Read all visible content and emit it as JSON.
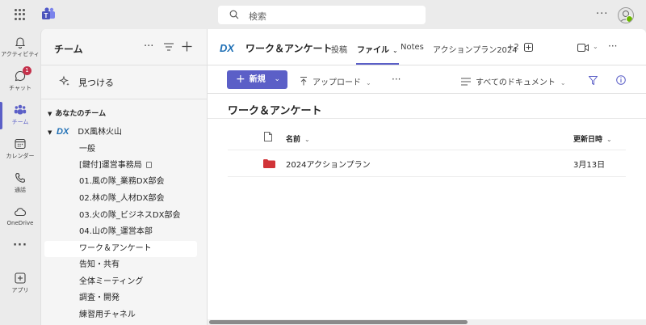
{
  "topbar": {
    "search_placeholder": "検索",
    "more": "···"
  },
  "rail": {
    "activity": "アクティビティ",
    "chat": "チャット",
    "chat_badge": "1",
    "teams": "チーム",
    "calendar": "カレンダー",
    "calls": "通話",
    "onedrive": "OneDrive",
    "more": "···",
    "apps": "アプリ"
  },
  "panel": {
    "title": "チーム",
    "more": "···",
    "discover": "見つける",
    "section": "あなたのチーム",
    "team_name": "DX風林火山",
    "channels": [
      "一般",
      "[鍵付]運営事務局",
      "01.風の隊_業務DX部会",
      "02.林の隊_人材DX部会",
      "03.火の隊_ビジネスDX部会",
      "04.山の隊_運営本部",
      "ワーク＆アンケート",
      "告知・共有",
      "全体ミーティング",
      "調査・開発",
      "練習用チャネル"
    ]
  },
  "header": {
    "channel_name": "ワーク＆アンケート",
    "tabs": [
      "投稿",
      "ファイル",
      "Notes",
      "アクションプラン2024"
    ],
    "extra_tabs": "+2",
    "more": "···"
  },
  "toolbar": {
    "new_label": "新規",
    "upload_label": "アップロード",
    "more": "···",
    "view_label": "すべてのドキュメント"
  },
  "library": {
    "title": "ワーク＆アンケート",
    "columns": {
      "name": "名前",
      "modified": "更新日時"
    },
    "rows": [
      {
        "name": "2024アクションプラン",
        "modified": "3月13日"
      }
    ]
  },
  "colors": {
    "accent": "#5b5fc7",
    "folder": "#d13438",
    "badge": "#c4314b"
  }
}
